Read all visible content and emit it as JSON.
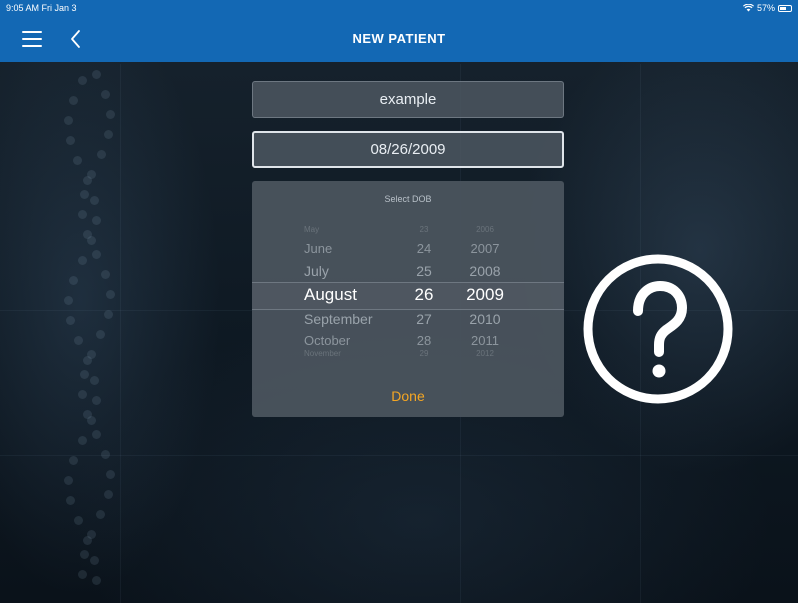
{
  "status_bar": {
    "time_date": "9:05 AM  Fri Jan 3",
    "battery": "57%",
    "battery_level": 0.57
  },
  "nav": {
    "title": "NEW PATIENT",
    "menu_icon": "hamburger-menu-icon",
    "back_icon": "chevron-left-icon"
  },
  "form": {
    "name_value": "example",
    "dob_value": "08/26/2009"
  },
  "picker": {
    "title": "Select DOB",
    "months": [
      "May",
      "June",
      "July",
      "August",
      "September",
      "October",
      "November"
    ],
    "days": [
      "23",
      "24",
      "25",
      "26",
      "27",
      "28",
      "29"
    ],
    "years": [
      "2006",
      "2007",
      "2008",
      "2009",
      "2010",
      "2011",
      "2012"
    ],
    "selected_index": 3,
    "done_label": "Done"
  },
  "help": {
    "icon": "question-mark-icon"
  },
  "colors": {
    "accent": "#1368b4",
    "done": "#f5a623"
  }
}
